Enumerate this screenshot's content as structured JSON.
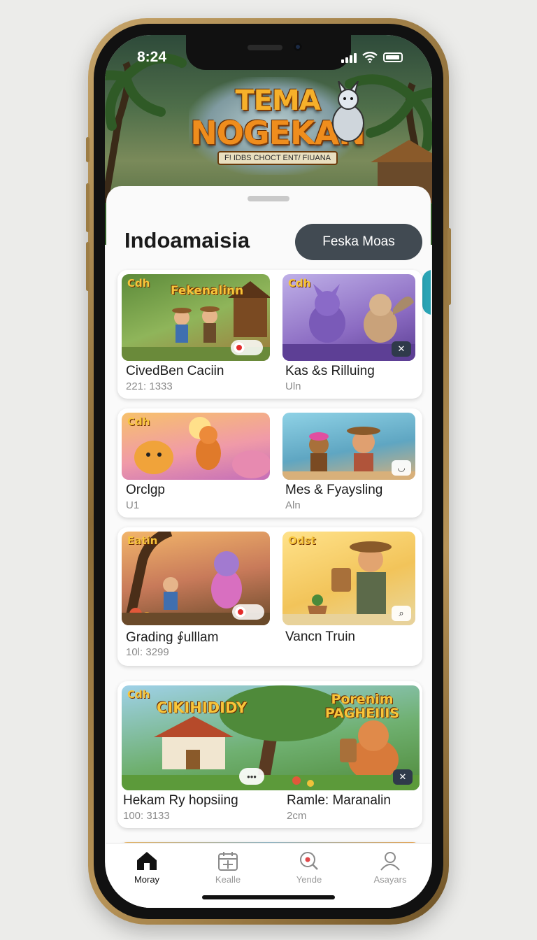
{
  "status": {
    "time": "8:24"
  },
  "hero": {
    "logo_line1": "TEMA",
    "logo_line2": "NOGEKAN",
    "logo_sub": "F! IDBS CHOCT ENT/ FIUANA"
  },
  "header": {
    "title": "Indoamaisia",
    "action_label": "Feska Moas"
  },
  "cards": [
    {
      "name": "CivedBen Caciin",
      "meta": "221: 1333",
      "tag": "Cdh",
      "banner": "Fekenalinn"
    },
    {
      "name": "Kas &s Rilluing",
      "meta": "Uln",
      "tag": "Cdh",
      "banner": ""
    },
    {
      "name": "Orclgp",
      "meta": "U1",
      "tag": "Cdh",
      "banner": ""
    },
    {
      "name": "Mes & Fyaysling",
      "meta": "Aln",
      "tag": "",
      "banner": ""
    },
    {
      "name": "Grading ∮ulllam",
      "meta": "10l: 3299",
      "tag": "Eatin",
      "banner": ""
    },
    {
      "name": "Vancn Truin",
      "meta": "",
      "tag": "Odst",
      "banner": ""
    },
    {
      "name": "Hekam Ry hopsiing",
      "meta": "100: 3133",
      "tag": "Cdh",
      "banner": "CIKIHIDIDY"
    },
    {
      "name": "Ramle: Maranalin",
      "meta": "2cm",
      "tag": "",
      "banner": "Porenim PAGHEIIIS"
    }
  ],
  "tabs": [
    {
      "label": "Moray",
      "icon": "home-icon",
      "active": true
    },
    {
      "label": "Kealle",
      "icon": "calendar-icon",
      "active": false
    },
    {
      "label": "Yende",
      "icon": "search-icon",
      "active": false
    },
    {
      "label": "Asayars",
      "icon": "profile-icon",
      "active": false
    }
  ]
}
